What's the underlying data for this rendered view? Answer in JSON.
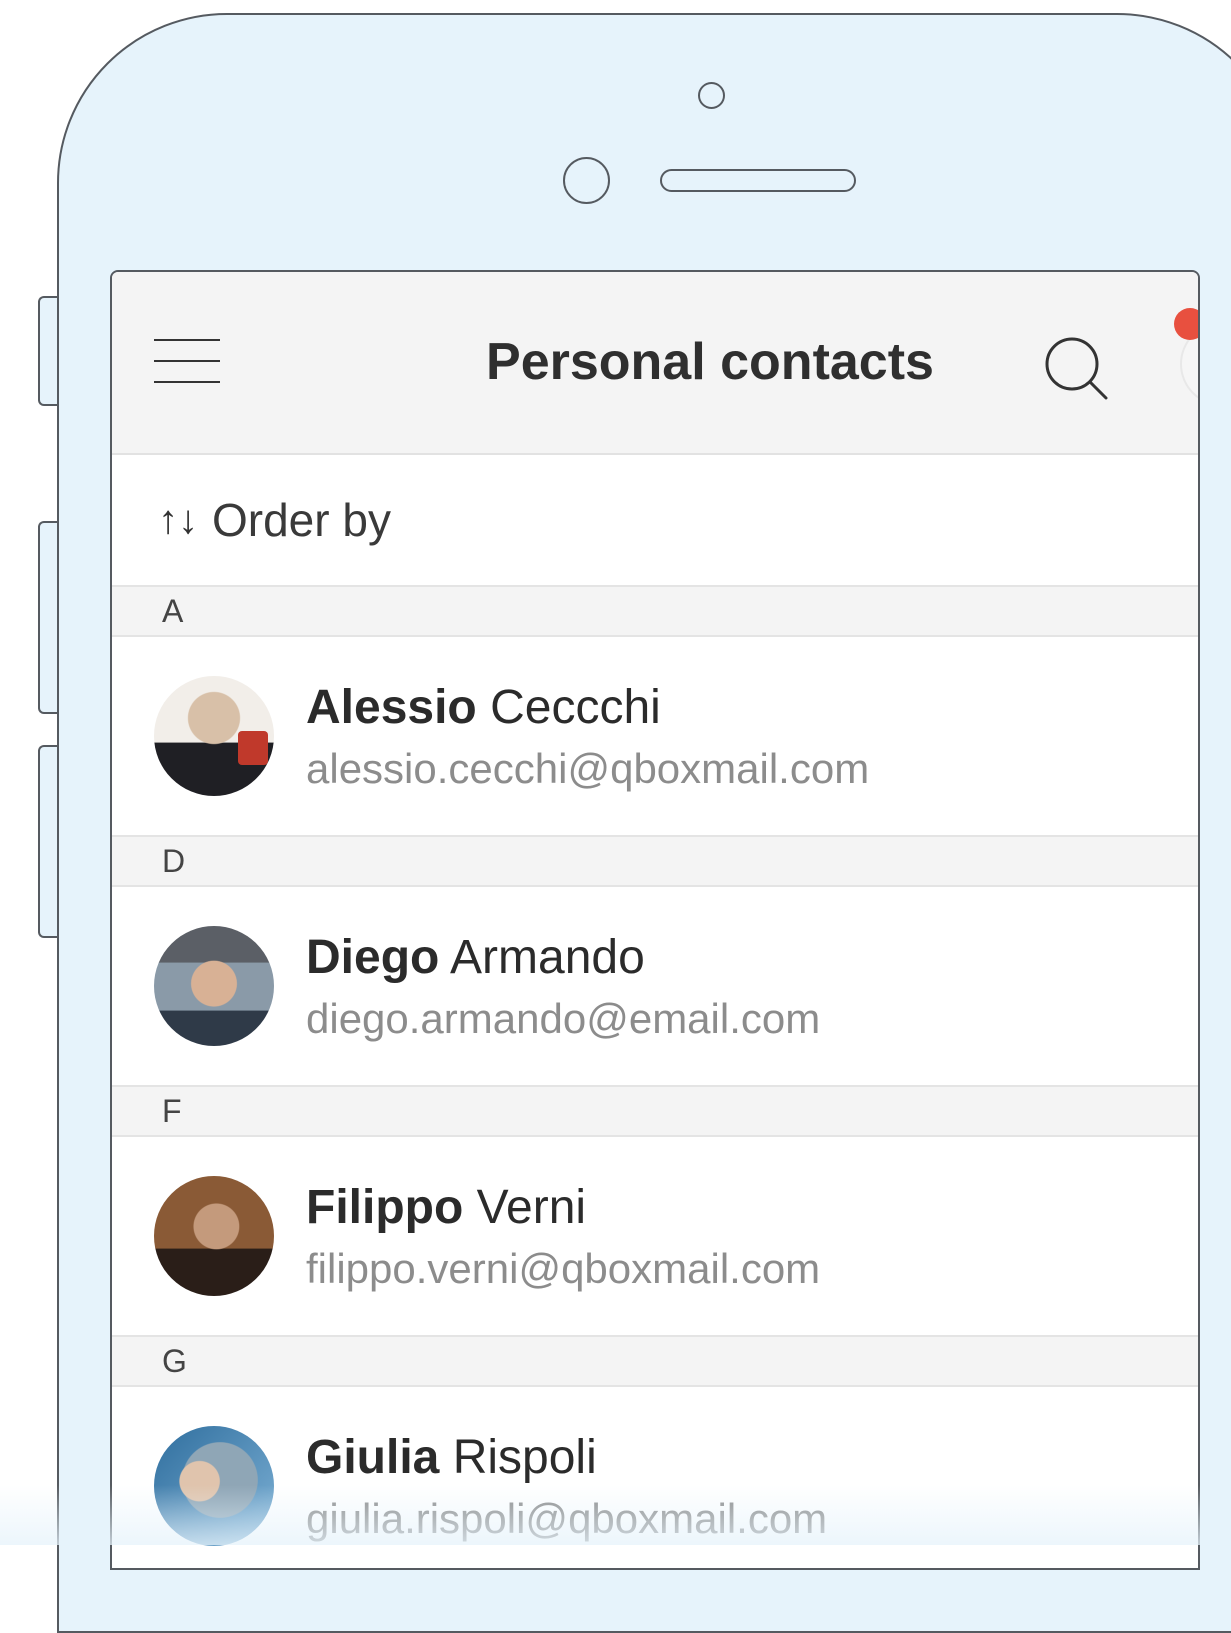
{
  "header": {
    "title": "Personal contacts"
  },
  "order": {
    "arrows": "↑↓",
    "label": "Order by"
  },
  "sections": [
    {
      "letter": "A",
      "contact": {
        "first": "Alessio",
        "last": "Ceccchi",
        "email": "alessio.cecchi@qboxmail.com",
        "avatar_color": "#c9b7a4"
      }
    },
    {
      "letter": "D",
      "contact": {
        "first": "Diego",
        "last": "Armando",
        "email": "diego.armando@email.com",
        "avatar_color": "#7a6a55"
      }
    },
    {
      "letter": "F",
      "contact": {
        "first": "Filippo",
        "last": "Verni",
        "email": "filippo.verni@qboxmail.com",
        "avatar_color": "#6b4a33"
      }
    },
    {
      "letter": "G",
      "contact": {
        "first": "Giulia",
        "last": "Rispoli",
        "email": "giulia.rispoli@qboxmail.com",
        "avatar_color": "#4a7fa8"
      }
    }
  ],
  "colors": {
    "notification": "#e8503f",
    "phone_body": "#e6f3fb"
  }
}
